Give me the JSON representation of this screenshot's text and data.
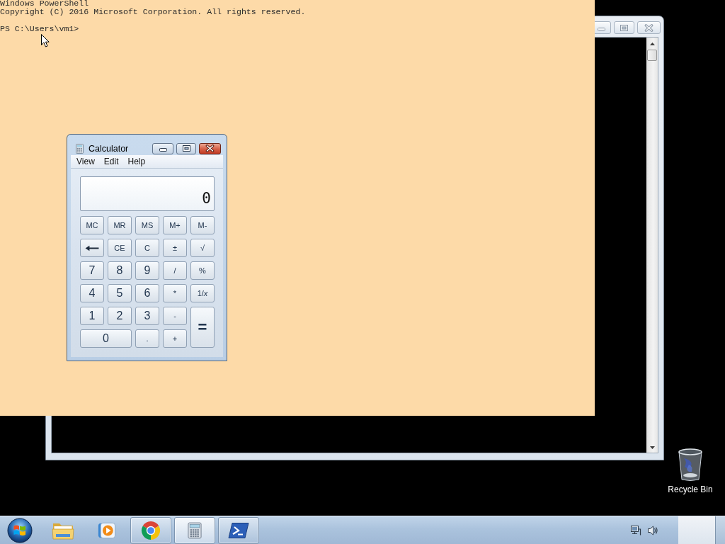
{
  "console_window": {
    "active": false
  },
  "console": {
    "lines": [
      "Windows PowerShell",
      "Copyright (C) 2016 Microsoft Corporation. All rights reserved."
    ],
    "prompt": "PS C:\\Users\\vm1>"
  },
  "calculator": {
    "title": "Calculator",
    "active": true,
    "menu": [
      {
        "label": "View"
      },
      {
        "label": "Edit"
      },
      {
        "label": "Help"
      }
    ],
    "display": "0",
    "keys": [
      {
        "label": "MC",
        "kind": "key"
      },
      {
        "label": "MR",
        "kind": "key"
      },
      {
        "label": "MS",
        "kind": "key"
      },
      {
        "label": "M+",
        "kind": "key"
      },
      {
        "label": "M-",
        "kind": "key"
      },
      {
        "kind": "backspace"
      },
      {
        "label": "CE",
        "kind": "key"
      },
      {
        "label": "C",
        "kind": "key"
      },
      {
        "label": "±",
        "kind": "key"
      },
      {
        "label": "√",
        "kind": "key"
      },
      {
        "label": "7",
        "kind": "digit"
      },
      {
        "label": "8",
        "kind": "digit"
      },
      {
        "label": "9",
        "kind": "digit"
      },
      {
        "label": "/",
        "kind": "key"
      },
      {
        "label": "%",
        "kind": "key"
      },
      {
        "label": "4",
        "kind": "digit"
      },
      {
        "label": "5",
        "kind": "digit"
      },
      {
        "label": "6",
        "kind": "digit"
      },
      {
        "label": "*",
        "kind": "key"
      },
      {
        "label": "1/*x*",
        "kind": "key"
      },
      {
        "label": "1",
        "kind": "digit"
      },
      {
        "label": "2",
        "kind": "digit"
      },
      {
        "label": "3",
        "kind": "digit"
      },
      {
        "label": "-",
        "kind": "key"
      },
      {
        "label": "=",
        "kind": "tall"
      },
      {
        "label": "0",
        "kind": "wide"
      },
      {
        "label": ".",
        "kind": "key"
      },
      {
        "label": "+",
        "kind": "key"
      }
    ]
  },
  "desktop_icons": [
    {
      "label": "Recycle Bin",
      "kind": "recycle-bin"
    }
  ],
  "taskbar": {
    "items": [
      {
        "kind": "folder",
        "running": false,
        "selected": false
      },
      {
        "kind": "media",
        "running": false,
        "selected": false
      },
      {
        "kind": "browser",
        "running": true,
        "selected": false
      },
      {
        "kind": "calculator",
        "running": true,
        "selected": true
      },
      {
        "kind": "terminal",
        "running": true,
        "selected": false
      }
    ]
  }
}
